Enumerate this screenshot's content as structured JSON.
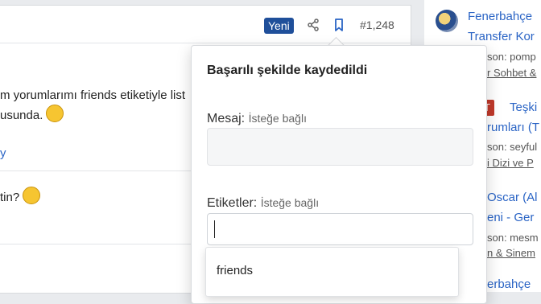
{
  "post": {
    "badge": "Yeni",
    "number": "#1,248",
    "body_line1": "m yorumlarımı friends etiketiyle list",
    "body_line2": "usunda.",
    "link_fragment": "y",
    "reply": "tin?"
  },
  "popover": {
    "title": "Başarılı şekilde kaydedildi",
    "message_label": "Mesaj:",
    "message_optional": "İsteğe bağlı",
    "tags_label": "Etiketler:",
    "tags_optional": "İsteğe bağlı",
    "tags_value": "",
    "suggestion": "friends"
  },
  "sidebar": {
    "items": [
      {
        "title1": "Fenerbahçe",
        "title2": "Transfer Kor",
        "meta": "son: pomp",
        "sub": "r Sohbet &"
      },
      {
        "title1": "Teşki",
        "title2": "rumları (T",
        "meta": "son: seyful",
        "sub": "i Dizi ve P"
      },
      {
        "title1": "Oscar (Al",
        "title2": "eni - Ger",
        "meta": "son: mesm",
        "sub": "n & Sinem"
      },
      {
        "title1": "erbahçe"
      }
    ],
    "badge": "T 1"
  },
  "icons": [
    "share-icon",
    "bookmark-icon",
    "laugh-emoji-icon",
    "thinking-emoji-icon",
    "team-logo-icon"
  ],
  "colors": {
    "accent": "#2a64c5",
    "badge": "#1f4f9a",
    "hot_badge": "#c0392b"
  }
}
